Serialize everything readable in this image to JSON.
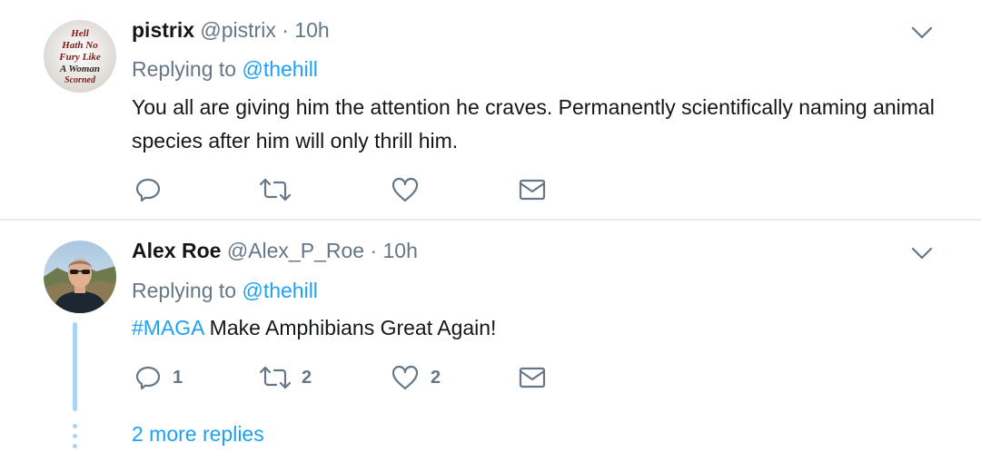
{
  "tweets": [
    {
      "name": "pistrix",
      "handle": "@pistrix",
      "separator": "·",
      "time": "10h",
      "replying_prefix": "Replying to",
      "replying_to": "@thehill",
      "text": "You all are giving him the attention he craves.  Permanently scientifically naming animal species after him will only thrill him.",
      "avatar_text": [
        "Hell",
        "Hath No",
        "Fury Like",
        "A Woman",
        "Scorned"
      ],
      "actions": {
        "reply": "",
        "retweet": "",
        "like": ""
      }
    },
    {
      "name": "Alex Roe",
      "handle": "@Alex_P_Roe",
      "separator": "·",
      "time": "10h",
      "replying_prefix": "Replying to",
      "replying_to": "@thehill",
      "hashtag": "#MAGA",
      "text": " Make Amphibians Great Again!",
      "actions": {
        "reply": "1",
        "retweet": "2",
        "like": "2"
      },
      "more_replies": "2 more replies"
    }
  ],
  "icons": {
    "reply": "reply-icon",
    "retweet": "retweet-icon",
    "like": "heart-icon",
    "dm": "envelope-icon",
    "caret": "chevron-down-icon"
  },
  "colors": {
    "link": "#1da1f2",
    "muted": "#657786",
    "text": "#14171a",
    "thread": "#a9d4f5",
    "divider": "#e6ecf0"
  }
}
